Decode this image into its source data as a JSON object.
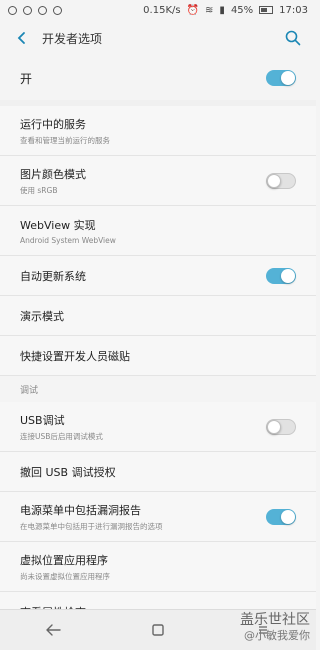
{
  "status": {
    "speed": "0.15K/s",
    "battery": "45%",
    "time": "17:03"
  },
  "header": {
    "title": "开发者选项"
  },
  "master": {
    "label": "开",
    "toggle_on": true
  },
  "items": [
    {
      "title": "运行中的服务",
      "subtitle": "查看和管理当前运行的服务"
    },
    {
      "title": "图片颜色模式",
      "subtitle": "使用 sRGB",
      "toggle_on": false
    },
    {
      "title": "WebView 实现",
      "subtitle": "Android System WebView"
    },
    {
      "title": "自动更新系统",
      "toggle_on": true
    },
    {
      "title": "演示模式"
    },
    {
      "title": "快捷设置开发人员磁贴"
    }
  ],
  "section": {
    "label": "调试"
  },
  "debug_items": [
    {
      "title": "USB调试",
      "subtitle": "连接USB后启用调试模式",
      "toggle_on": false
    },
    {
      "title": "撤回 USB 调试授权"
    },
    {
      "title": "电源菜单中包括漏洞报告",
      "subtitle": "在电源菜单中包括用于进行漏洞报告的选项",
      "toggle_on": true
    },
    {
      "title": "虚拟位置应用程序",
      "subtitle": "尚未设置虚拟位置应用程序"
    },
    {
      "title": "查看属性检查"
    }
  ],
  "watermark": {
    "line1": "盖乐世社区",
    "line2": "@小敏我爱你"
  },
  "colors": {
    "accent": "#1a86b4",
    "toggle_on": "#54b2d6"
  }
}
